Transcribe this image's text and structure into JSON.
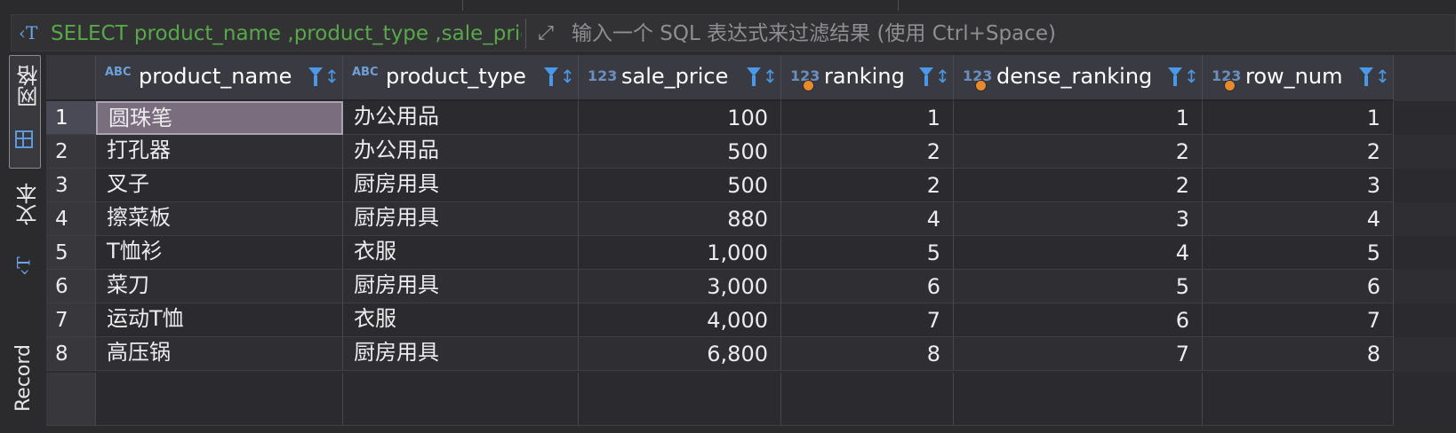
{
  "filter": {
    "sql_text": "SELECT product_name ,product_type ,sale_price ,RANK() OVER",
    "placeholder": "输入一个 SQL 表达式来过滤结果 (使用 Ctrl+Space)"
  },
  "sidebar": {
    "grid_label": "网格",
    "text_label": "文本",
    "record_label": "Record"
  },
  "columns": [
    {
      "label": "product_name",
      "type": "ABC"
    },
    {
      "label": "product_type",
      "type": "ABC"
    },
    {
      "label": "sale_price",
      "type": "123"
    },
    {
      "label": "ranking",
      "type": "123"
    },
    {
      "label": "dense_ranking",
      "type": "123"
    },
    {
      "label": "row_num",
      "type": "123"
    }
  ],
  "rows": [
    {
      "n": "1",
      "product_name": "圆珠笔",
      "product_type": "办公用品",
      "sale_price": "100",
      "ranking": "1",
      "dense_ranking": "1",
      "row_num": "1"
    },
    {
      "n": "2",
      "product_name": "打孔器",
      "product_type": "办公用品",
      "sale_price": "500",
      "ranking": "2",
      "dense_ranking": "2",
      "row_num": "2"
    },
    {
      "n": "3",
      "product_name": "叉子",
      "product_type": "厨房用具",
      "sale_price": "500",
      "ranking": "2",
      "dense_ranking": "2",
      "row_num": "3"
    },
    {
      "n": "4",
      "product_name": "擦菜板",
      "product_type": "厨房用具",
      "sale_price": "880",
      "ranking": "4",
      "dense_ranking": "3",
      "row_num": "4"
    },
    {
      "n": "5",
      "product_name": "T恤衫",
      "product_type": "衣服",
      "sale_price": "1,000",
      "ranking": "5",
      "dense_ranking": "4",
      "row_num": "5"
    },
    {
      "n": "6",
      "product_name": "菜刀",
      "product_type": "厨房用具",
      "sale_price": "3,000",
      "ranking": "6",
      "dense_ranking": "5",
      "row_num": "6"
    },
    {
      "n": "7",
      "product_name": "运动T恤",
      "product_type": "衣服",
      "sale_price": "4,000",
      "ranking": "7",
      "dense_ranking": "6",
      "row_num": "7"
    },
    {
      "n": "8",
      "product_name": "高压锅",
      "product_type": "厨房用具",
      "sale_price": "6,800",
      "ranking": "8",
      "dense_ranking": "7",
      "row_num": "8"
    }
  ],
  "colors": {
    "sql_text": "#58a84a",
    "accent_blue": "#4a98e8",
    "key_dot": "#e88a2c",
    "selected_cell": "#7a6d7e"
  }
}
